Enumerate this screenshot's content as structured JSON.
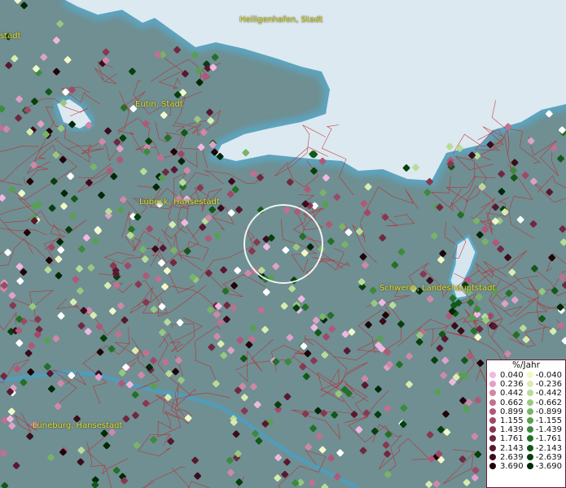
{
  "map": {
    "land_color": "#6f8f92",
    "sea_color": "#dce9f0",
    "coast_glow_color": "#5aa7c6",
    "border_color": "#c0262b",
    "selection_ring_color": "#ffffff"
  },
  "cities": [
    {
      "id": "heiligenhafen",
      "label": "Heiligenhafen, Stadt"
    },
    {
      "id": "eutin",
      "label": "Eutin, Stadt"
    },
    {
      "id": "luebeck",
      "label": "Lübeck, Hansestadt"
    },
    {
      "id": "schwerin",
      "label": "Schwerin, Landeshauptstadt"
    },
    {
      "id": "lueneburg",
      "label": "Lüneburg, Hansestadt"
    },
    {
      "id": "stadt-edge",
      "label": "stadt"
    }
  ],
  "legend": {
    "title": "%/Jahr",
    "positive": [
      {
        "label": "0.040",
        "color": "#f0b8e0"
      },
      {
        "label": "0.236",
        "color": "#e0a0c8"
      },
      {
        "label": "0.442",
        "color": "#d088a8"
      },
      {
        "label": "0.662",
        "color": "#c07090"
      },
      {
        "label": "0.899",
        "color": "#b05878"
      },
      {
        "label": "1.155",
        "color": "#a04868"
      },
      {
        "label": "1.439",
        "color": "#883850"
      },
      {
        "label": "1.761",
        "color": "#702840"
      },
      {
        "label": "2.143",
        "color": "#581830"
      },
      {
        "label": "2.639",
        "color": "#3a0c1c"
      },
      {
        "label": "3.690",
        "color": "#200408"
      }
    ],
    "negative": [
      {
        "label": "-0.040",
        "color": "#f2f8c8"
      },
      {
        "label": "-0.236",
        "color": "#d8ecb0"
      },
      {
        "label": "-0.442",
        "color": "#b8dc98"
      },
      {
        "label": "-0.662",
        "color": "#98c880"
      },
      {
        "label": "-0.899",
        "color": "#78b468"
      },
      {
        "label": "-1.155",
        "color": "#58a050"
      },
      {
        "label": "-1.439",
        "color": "#3c8a3c"
      },
      {
        "label": "-1.761",
        "color": "#247028"
      },
      {
        "label": "-2.143",
        "color": "#125818"
      },
      {
        "label": "-2.639",
        "color": "#06400c"
      },
      {
        "label": "-3.690",
        "color": "#022806"
      }
    ]
  }
}
